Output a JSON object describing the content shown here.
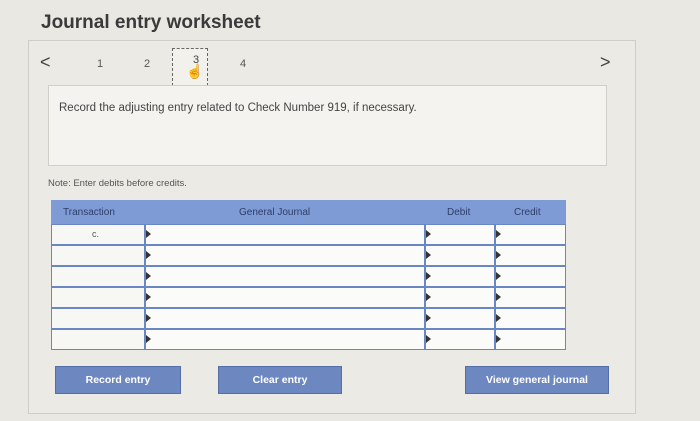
{
  "header": {
    "title": "Journal entry worksheet"
  },
  "nav": {
    "prev_icon": "chevron-left-icon",
    "next_icon": "chevron-right-icon",
    "prev_glyph": "<",
    "next_glyph": ">",
    "steps": [
      "1",
      "2",
      "3",
      "4"
    ],
    "active_step": "3",
    "hand_glyph": "☝"
  },
  "instruction": "Record the adjusting entry related to Check Number 919, if necessary.",
  "note": "Note: Enter debits before credits.",
  "table": {
    "columns": [
      "Transaction",
      "General Journal",
      "Debit",
      "Credit"
    ],
    "rows": [
      {
        "transaction": "c.",
        "general_journal": "",
        "debit": "",
        "credit": ""
      },
      {
        "transaction": "",
        "general_journal": "",
        "debit": "",
        "credit": ""
      },
      {
        "transaction": "",
        "general_journal": "",
        "debit": "",
        "credit": ""
      },
      {
        "transaction": "",
        "general_journal": "",
        "debit": "",
        "credit": ""
      },
      {
        "transaction": "",
        "general_journal": "",
        "debit": "",
        "credit": ""
      },
      {
        "transaction": "",
        "general_journal": "",
        "debit": "",
        "credit": ""
      }
    ]
  },
  "buttons": {
    "record": "Record entry",
    "clear": "Clear entry",
    "view": "View general journal"
  },
  "colors": {
    "table_header": "#7f9bd6",
    "button": "#6d87c1"
  }
}
